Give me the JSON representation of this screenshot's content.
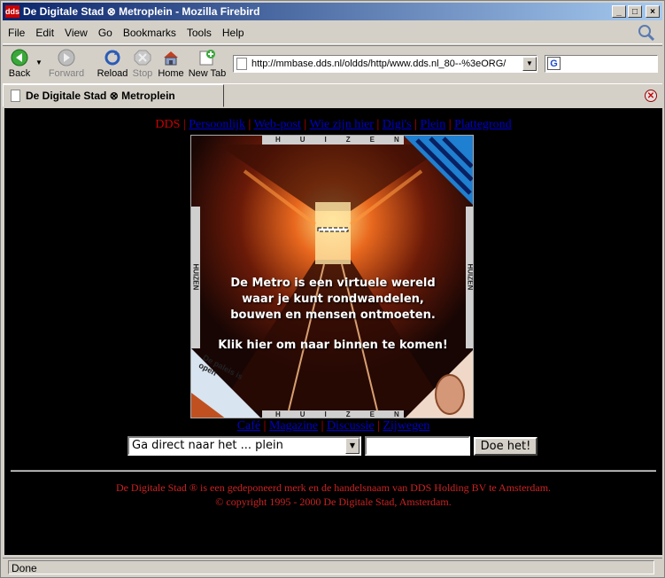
{
  "window": {
    "title": "De Digitale Stad ⊗ Metroplein - Mozilla Firebird",
    "minimize": "_",
    "maximize": "□",
    "close": "×"
  },
  "menu": [
    "File",
    "Edit",
    "View",
    "Go",
    "Bookmarks",
    "Tools",
    "Help"
  ],
  "toolbar": {
    "back": "Back",
    "forward": "Forward",
    "reload": "Reload",
    "stop": "Stop",
    "home": "Home",
    "new_tab": "New Tab"
  },
  "address": {
    "url": "http://mmbase.dds.nl/oldds/http/www.dds.nl_80--%3eORG/"
  },
  "tab": {
    "title": "De Digitale Stad ⊗ Metroplein"
  },
  "page": {
    "nav_current": "DDS",
    "nav_links": [
      "Persoonlijk",
      "Web-post",
      "Wie zijn hier",
      "Digi's",
      "Plein",
      "Plattegrond"
    ],
    "banner": {
      "frame_label": "HUIZEN",
      "sign": "De paleis is open",
      "line1": "De Metro is een virtuele wereld",
      "line2": "waar je kunt rondwandelen,",
      "line3": "bouwen en mensen ontmoeten.",
      "enter": "Klik hier om naar binnen te komen!"
    },
    "sub_links": [
      "Café",
      "Magazine",
      "Discussie",
      "Zijwegen"
    ],
    "select_value": "Ga direct naar het ... plein",
    "submit": "Doe het!",
    "footer_line1": "De Digitale Stad ® is een gedeponeerd merk en de handelsnaam van DDS Holding BV te Amsterdam.",
    "footer_line2": "© copyright 1995 - 2000 De Digitale Stad, Amsterdam."
  },
  "status": "Done",
  "colors": {
    "link": "#0000cc",
    "text_red": "#cc0000",
    "background": "#000000",
    "chrome": "#d4d0c8"
  }
}
